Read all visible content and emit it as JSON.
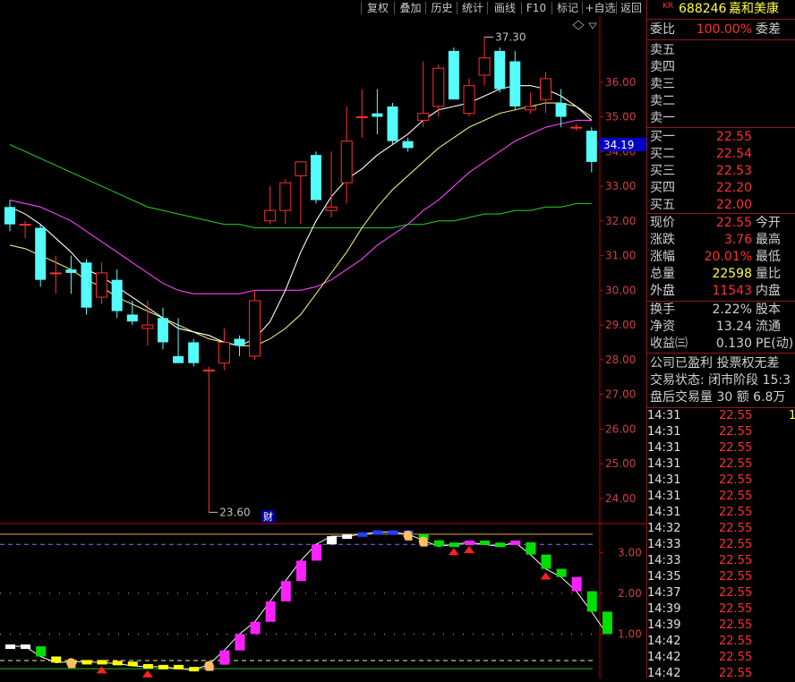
{
  "toolbar": {
    "buttons": [
      "复权",
      "叠加",
      "历史",
      "统计",
      "画线",
      "F10",
      "标记",
      "+自选",
      "返回"
    ]
  },
  "chart": {
    "y_axis_labels": [
      "36.00",
      "35.00",
      "34.00",
      "33.00",
      "32.00",
      "31.00",
      "30.00",
      "29.00",
      "28.00",
      "27.00",
      "26.00",
      "25.00",
      "24.00"
    ],
    "current_price_tag": "34.19",
    "high_marker": "37.30",
    "low_marker": "23.60",
    "finance_badge": "财",
    "indicator_axis_labels": [
      "3.00",
      "2.00",
      "1.00"
    ],
    "colors": {
      "up": "#ff3030",
      "down": "#54fcfc",
      "ma5": "#ffffff",
      "ma10": "#e8e878",
      "ma20": "#ff40ff",
      "ma60": "#20c020",
      "axis": "#c00000"
    }
  },
  "chart_data": {
    "type": "candlestick",
    "ylim": [
      23.3,
      37.8
    ],
    "candles": [
      {
        "o": 32.4,
        "h": 32.6,
        "l": 31.7,
        "c": 31.9
      },
      {
        "o": 31.9,
        "h": 32.0,
        "l": 31.5,
        "c": 31.9
      },
      {
        "o": 31.8,
        "h": 31.9,
        "l": 30.1,
        "c": 30.3
      },
      {
        "o": 30.5,
        "h": 31.0,
        "l": 29.9,
        "c": 30.5
      },
      {
        "o": 30.6,
        "h": 31.0,
        "l": 29.9,
        "c": 30.5
      },
      {
        "o": 30.8,
        "h": 30.9,
        "l": 29.3,
        "c": 29.5
      },
      {
        "o": 29.8,
        "h": 30.8,
        "l": 29.6,
        "c": 30.5
      },
      {
        "o": 30.3,
        "h": 30.6,
        "l": 29.2,
        "c": 29.4
      },
      {
        "o": 29.3,
        "h": 29.7,
        "l": 29.0,
        "c": 29.1
      },
      {
        "o": 28.9,
        "h": 29.7,
        "l": 28.4,
        "c": 29.0
      },
      {
        "o": 29.2,
        "h": 29.5,
        "l": 28.3,
        "c": 28.5
      },
      {
        "o": 28.1,
        "h": 29.2,
        "l": 27.9,
        "c": 27.9
      },
      {
        "o": 28.5,
        "h": 28.6,
        "l": 27.8,
        "c": 27.9
      },
      {
        "o": 27.7,
        "h": 27.8,
        "l": 23.6,
        "c": 27.7
      },
      {
        "o": 27.9,
        "h": 28.9,
        "l": 27.7,
        "c": 28.5
      },
      {
        "o": 28.6,
        "h": 28.7,
        "l": 28.1,
        "c": 28.4
      },
      {
        "o": 28.1,
        "h": 30.0,
        "l": 28.0,
        "c": 29.7
      },
      {
        "o": 32.0,
        "h": 33.0,
        "l": 31.9,
        "c": 32.3
      },
      {
        "o": 32.3,
        "h": 33.2,
        "l": 31.9,
        "c": 33.1
      },
      {
        "o": 33.3,
        "h": 33.7,
        "l": 31.9,
        "c": 33.7
      },
      {
        "o": 33.9,
        "h": 34.0,
        "l": 32.5,
        "c": 32.6
      },
      {
        "o": 32.3,
        "h": 34.0,
        "l": 32.1,
        "c": 32.4
      },
      {
        "o": 33.1,
        "h": 35.3,
        "l": 32.5,
        "c": 34.3
      },
      {
        "o": 35.0,
        "h": 35.8,
        "l": 34.4,
        "c": 35.0
      },
      {
        "o": 35.1,
        "h": 35.8,
        "l": 34.5,
        "c": 35.0
      },
      {
        "o": 35.3,
        "h": 35.4,
        "l": 34.2,
        "c": 34.3
      },
      {
        "o": 34.3,
        "h": 34.4,
        "l": 34.0,
        "c": 34.1
      },
      {
        "o": 34.9,
        "h": 36.6,
        "l": 34.7,
        "c": 35.1
      },
      {
        "o": 35.3,
        "h": 36.5,
        "l": 35.0,
        "c": 36.4
      },
      {
        "o": 36.9,
        "h": 37.0,
        "l": 35.5,
        "c": 35.5
      },
      {
        "o": 35.1,
        "h": 36.1,
        "l": 35.0,
        "c": 35.9
      },
      {
        "o": 36.2,
        "h": 37.3,
        "l": 35.9,
        "c": 36.7
      },
      {
        "o": 36.9,
        "h": 37.0,
        "l": 35.7,
        "c": 35.8
      },
      {
        "o": 36.6,
        "h": 36.9,
        "l": 35.2,
        "c": 35.3
      },
      {
        "o": 35.2,
        "h": 35.7,
        "l": 35.1,
        "c": 35.3
      },
      {
        "o": 35.5,
        "h": 36.3,
        "l": 35.1,
        "c": 36.1
      },
      {
        "o": 35.4,
        "h": 35.8,
        "l": 34.7,
        "c": 35.0
      },
      {
        "o": 34.7,
        "h": 34.8,
        "l": 34.6,
        "c": 34.7
      },
      {
        "o": 34.6,
        "h": 34.7,
        "l": 33.4,
        "c": 33.7
      }
    ],
    "ma5": [
      32.4,
      32.2,
      31.9,
      31.5,
      31.1,
      30.6,
      30.4,
      30.1,
      29.8,
      29.5,
      29.2,
      28.9,
      28.8,
      28.7,
      28.5,
      28.4,
      28.6,
      29.1,
      30.0,
      31.1,
      32.0,
      32.7,
      33.2,
      33.5,
      33.9,
      34.2,
      34.5,
      34.9,
      35.2,
      35.3,
      35.4,
      35.6,
      35.8,
      35.9,
      35.9,
      35.8,
      35.6,
      35.3,
      34.9
    ],
    "ma10": [
      31.3,
      31.2,
      31.0,
      30.8,
      30.6,
      30.3,
      30.1,
      29.8,
      29.6,
      29.4,
      29.2,
      29.0,
      28.8,
      28.6,
      28.5,
      28.4,
      28.4,
      28.6,
      28.9,
      29.3,
      29.9,
      30.5,
      31.1,
      31.8,
      32.4,
      32.9,
      33.3,
      33.7,
      34.1,
      34.4,
      34.7,
      34.9,
      35.1,
      35.2,
      35.3,
      35.4,
      35.4,
      35.3,
      35.0
    ],
    "ma20": [
      32.6,
      32.5,
      32.4,
      32.2,
      32.0,
      31.7,
      31.4,
      31.1,
      30.8,
      30.5,
      30.2,
      30.0,
      29.9,
      29.9,
      29.9,
      29.9,
      30.0,
      30.0,
      30.0,
      30.0,
      30.1,
      30.3,
      30.6,
      30.9,
      31.3,
      31.6,
      31.9,
      32.3,
      32.6,
      33.0,
      33.4,
      33.7,
      34.0,
      34.3,
      34.5,
      34.7,
      34.8,
      34.9,
      34.9
    ],
    "ma60": [
      34.2,
      34.0,
      33.8,
      33.6,
      33.4,
      33.2,
      33.0,
      32.8,
      32.6,
      32.4,
      32.3,
      32.2,
      32.1,
      32.0,
      31.9,
      31.9,
      31.8,
      31.8,
      31.8,
      31.8,
      31.8,
      31.8,
      31.8,
      31.8,
      31.8,
      31.8,
      31.9,
      31.9,
      32.0,
      32.0,
      32.1,
      32.2,
      32.2,
      32.3,
      32.3,
      32.4,
      32.4,
      32.5,
      32.5
    ],
    "indicator": {
      "ylim": [
        0.0,
        3.6
      ],
      "upper_line": 3.45,
      "dashed_purple": 3.2,
      "dotted_levels": [
        2.0,
        1.0
      ],
      "lower_dashed": 0.35,
      "lower_green": 0.15,
      "values": [
        0.7,
        0.7,
        0.45,
        0.3,
        0.32,
        0.32,
        0.3,
        0.28,
        0.22,
        0.2,
        0.2,
        0.15,
        0.12,
        0.25,
        0.6,
        1.0,
        1.3,
        1.8,
        2.3,
        2.8,
        3.2,
        3.4,
        3.4,
        3.45,
        3.5,
        3.5,
        3.45,
        3.3,
        3.15,
        3.2,
        3.25,
        3.2,
        3.15,
        3.25,
        2.95,
        2.6,
        2.4,
        2.05,
        1.55,
        1.0
      ],
      "colors": [
        "#ffffff",
        "#ffffff",
        "#00e000",
        "#ffff00",
        "#ffff00",
        "#ffff00",
        "#ffff00",
        "#ffff00",
        "#ffff00",
        "#ffff00",
        "#ffff00",
        "#ffff00",
        "#ffff00",
        "#ff20ff",
        "#ff20ff",
        "#ff20ff",
        "#ff20ff",
        "#ff20ff",
        "#ff20ff",
        "#ff20ff",
        "#ff20ff",
        "#ffffff",
        "#ffffff",
        "#2040ff",
        "#2040ff",
        "#2040ff",
        "#2040ff",
        "#00e000",
        "#00e000",
        "#00e000",
        "#ff20ff",
        "#00e000",
        "#00e000",
        "#ff20ff",
        "#00e000",
        "#00e000",
        "#00e000",
        "#ff20ff",
        "#00e000",
        "#00e000"
      ],
      "red_triangles": [
        6,
        9,
        29,
        30,
        35
      ],
      "hand_icons": [
        4,
        13,
        26,
        27
      ]
    }
  },
  "quote": {
    "header_badge": "KR",
    "code": "688246",
    "name": "嘉和美康",
    "weibi_label": "委比",
    "weibi_value": "100.00%",
    "weicha_label": "委差",
    "sells": [
      {
        "label": "卖五",
        "price": ""
      },
      {
        "label": "卖四",
        "price": ""
      },
      {
        "label": "卖三",
        "price": ""
      },
      {
        "label": "卖二",
        "price": ""
      },
      {
        "label": "卖一",
        "price": ""
      }
    ],
    "buys": [
      {
        "label": "买一",
        "price": "22.55"
      },
      {
        "label": "买二",
        "price": "22.54"
      },
      {
        "label": "买三",
        "price": "22.53"
      },
      {
        "label": "买四",
        "price": "22.20"
      },
      {
        "label": "买五",
        "price": "22.00"
      }
    ],
    "stats": [
      {
        "l1": "现价",
        "v": "22.55",
        "l2": "今开",
        "color": "#ff3030"
      },
      {
        "l1": "涨跌",
        "v": "3.76",
        "l2": "最高",
        "color": "#ff3030"
      },
      {
        "l1": "涨幅",
        "v": "20.01%",
        "l2": "最低",
        "color": "#ff3030"
      },
      {
        "l1": "总量",
        "v": "22598",
        "l2": "量比",
        "color": "#ffff40"
      },
      {
        "l1": "外盘",
        "v": "11543",
        "l2": "内盘",
        "color": "#ff3030"
      }
    ],
    "stats2": [
      {
        "l1": "换手",
        "v": "2.22%",
        "l2": "股本"
      },
      {
        "l1": "净资",
        "v": "13.24",
        "l2": "流通"
      },
      {
        "l1": "收益㈢",
        "v": "0.130",
        "l2": "PE(动)"
      }
    ],
    "notice": "公司已盈利 投票权无差",
    "trade_status": "交易状态: 闭市阶段 15:3",
    "after_hours": "盘后交易量 30 额 6.8万",
    "ticks": [
      {
        "t": "14:31",
        "p": "22.55",
        "v": "1"
      },
      {
        "t": "14:31",
        "p": "22.55",
        "v": ""
      },
      {
        "t": "14:31",
        "p": "22.55",
        "v": ""
      },
      {
        "t": "14:31",
        "p": "22.55",
        "v": ""
      },
      {
        "t": "14:31",
        "p": "22.55",
        "v": ""
      },
      {
        "t": "14:31",
        "p": "22.55",
        "v": ""
      },
      {
        "t": "14:31",
        "p": "22.55",
        "v": ""
      },
      {
        "t": "14:32",
        "p": "22.55",
        "v": ""
      },
      {
        "t": "14:33",
        "p": "22.55",
        "v": ""
      },
      {
        "t": "14:33",
        "p": "22.55",
        "v": ""
      },
      {
        "t": "14:35",
        "p": "22.55",
        "v": ""
      },
      {
        "t": "14:37",
        "p": "22.55",
        "v": ""
      },
      {
        "t": "14:39",
        "p": "22.55",
        "v": ""
      },
      {
        "t": "14:39",
        "p": "22.55",
        "v": ""
      },
      {
        "t": "14:42",
        "p": "22.55",
        "v": ""
      },
      {
        "t": "14:42",
        "p": "22.55",
        "v": ""
      },
      {
        "t": "14:42",
        "p": "22.55",
        "v": ""
      }
    ]
  }
}
